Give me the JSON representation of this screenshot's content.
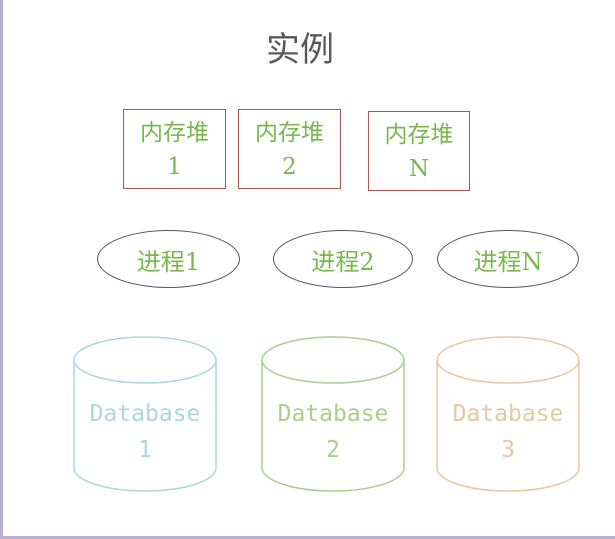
{
  "title": "实例",
  "heaps": [
    {
      "label": "内存堆",
      "index": "1"
    },
    {
      "label": "内存堆",
      "index": "2"
    },
    {
      "label": "内存堆",
      "index": "N"
    }
  ],
  "processes": [
    {
      "label": "进程1"
    },
    {
      "label": "进程2"
    },
    {
      "label": "进程N"
    }
  ],
  "databases": [
    {
      "label": "Database",
      "index": "1",
      "color": "#a8d8e0"
    },
    {
      "label": "Database",
      "index": "2",
      "color": "#a9cf8d"
    },
    {
      "label": "Database",
      "index": "3",
      "color": "#e8c8a0"
    }
  ],
  "colors": {
    "heap_border": "#a9565a",
    "text_green": "#78b84e",
    "process_border": "#555555",
    "title": "#595959"
  }
}
